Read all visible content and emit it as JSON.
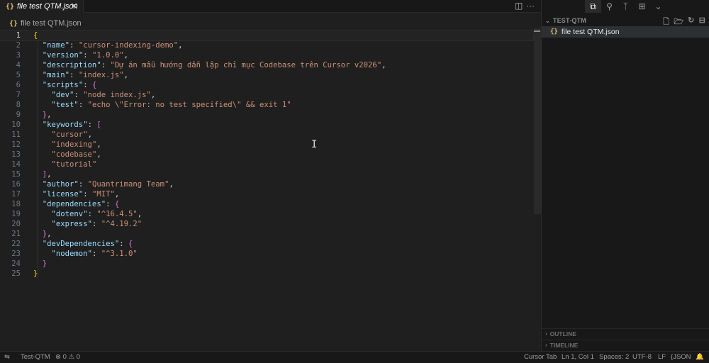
{
  "tab": {
    "label": "file test QTM.json",
    "icon": "json-braces-icon",
    "close": "✕"
  },
  "editor_actions": {
    "split": "▯",
    "more": "···"
  },
  "breadcrumb": {
    "file": "file test QTM.json",
    "icon": "{}"
  },
  "code_lines": [
    {
      "n": "1"
    },
    {
      "n": "2"
    },
    {
      "n": "3"
    },
    {
      "n": "4"
    },
    {
      "n": "5"
    },
    {
      "n": "6"
    },
    {
      "n": "7"
    },
    {
      "n": "8"
    },
    {
      "n": "9"
    },
    {
      "n": "10"
    },
    {
      "n": "11"
    },
    {
      "n": "12"
    },
    {
      "n": "13"
    },
    {
      "n": "14"
    },
    {
      "n": "15"
    },
    {
      "n": "16"
    },
    {
      "n": "17"
    },
    {
      "n": "18"
    },
    {
      "n": "19"
    },
    {
      "n": "20"
    },
    {
      "n": "21"
    },
    {
      "n": "22"
    },
    {
      "n": "23"
    },
    {
      "n": "24"
    },
    {
      "n": "25"
    }
  ],
  "json": {
    "name": "cursor-indexing-demo",
    "version": "1.0.0",
    "description": "Dự án mẫu hướng dẫn lập chỉ mục Codebase trên Cursor v2026",
    "main": "index.js",
    "scripts_dev": "node index.js",
    "scripts_test": "echo \\\"Error: no test specified\\\" && exit 1",
    "keywords": [
      "cursor",
      "indexing",
      "codebase",
      "tutorial"
    ],
    "author": "Quantrimang Team",
    "license": "MIT",
    "dep_dotenv": "^16.4.5",
    "dep_express": "^4.19.2",
    "devdep_nodemon": "^3.1.0"
  },
  "keys": {
    "name": "name",
    "version": "version",
    "description": "description",
    "main": "main",
    "scripts": "scripts",
    "dev": "dev",
    "test": "test",
    "keywords": "keywords",
    "author": "author",
    "license": "license",
    "dependencies": "dependencies",
    "dotenv": "dotenv",
    "express": "express",
    "devDependencies": "devDependencies",
    "nodemon": "nodemon"
  },
  "sidebar": {
    "activity_icons": [
      "copy-files-icon",
      "search-icon",
      "source-control-icon",
      "extensions-icon",
      "chevron-down-icon"
    ],
    "folder": "TEST-QTM",
    "file": "file test QTM.json",
    "outline": "OUTLINE",
    "timeline": "TIMELINE"
  },
  "status": {
    "branch_icon": "remote-icon",
    "workspace": "Test-QTM",
    "errors": "0",
    "warnings": "0",
    "cursor_tab": "Cursor Tab",
    "position": "Ln 1, Col 1",
    "spaces": "Spaces: 2",
    "encoding": "UTF-8",
    "eol": "LF",
    "language": "JSON",
    "bell_icon": "bell-icon"
  },
  "colors": {
    "background": "#1f1f1f",
    "key": "#9cdcfe",
    "string": "#ce9178",
    "brace": "#ffd700",
    "bracket": "#da70d6"
  }
}
